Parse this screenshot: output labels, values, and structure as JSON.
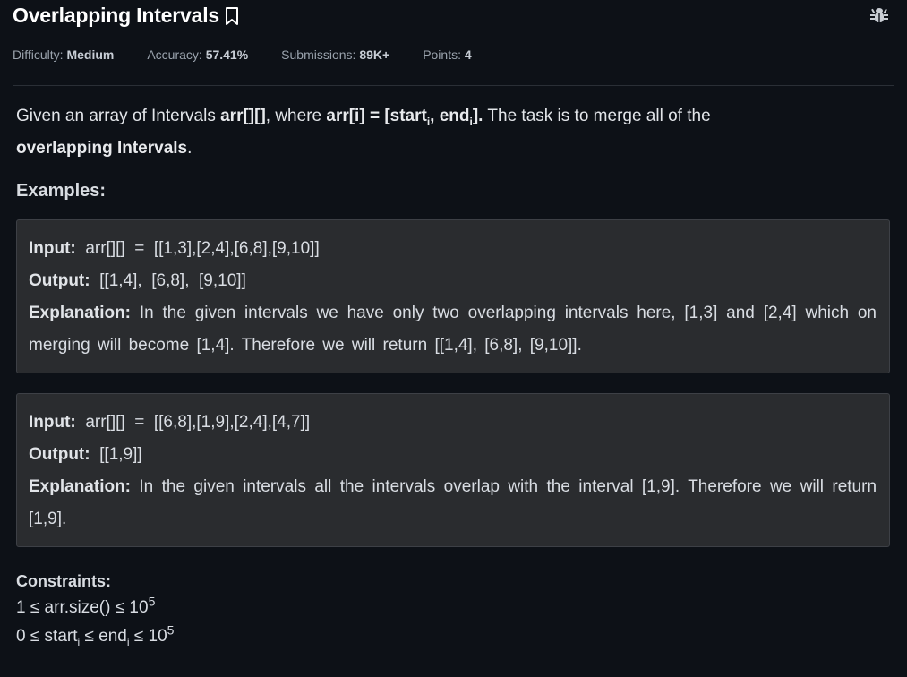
{
  "problem": {
    "title": "Overlapping Intervals",
    "meta": {
      "difficulty_label": "Difficulty:",
      "difficulty_value": "Medium",
      "accuracy_label": "Accuracy:",
      "accuracy_value": "57.41%",
      "submissions_label": "Submissions:",
      "submissions_value": "89K+",
      "points_label": "Points:",
      "points_value": "4"
    },
    "description": {
      "p1": "Given an array of Intervals ",
      "arr": "arr[][]",
      "p2": ", where ",
      "arri": "arr[i] = [start",
      "sub_i1": "i",
      "comma_end": ", end",
      "sub_i2": "i",
      "close": "].",
      "p3": " The task is to merge all of the ",
      "bold_end": "overlapping Intervals",
      "period": "."
    },
    "examples_heading": "Examples:",
    "examples": [
      {
        "input_label": "Input:",
        "input_value": "arr[][]  =  [[1,3],[2,4],[6,8],[9,10]]",
        "output_label": "Output:",
        "output_value": "[[1,4],  [6,8],  [9,10]]",
        "explanation_label": "Explanation:",
        "explanation_value": "In the given intervals we have only two overlapping intervals here, [1,3] and [2,4] which on merging will become [1,4]. Therefore we will return [[1,4], [6,8], [9,10]]."
      },
      {
        "input_label": "Input:",
        "input_value": "arr[][]  =  [[6,8],[1,9],[2,4],[4,7]]",
        "output_label": "Output:",
        "output_value": "[[1,9]]",
        "explanation_label": "Explanation:",
        "explanation_value": "In the given intervals all the intervals overlap with the interval [1,9]. Therefore we will return [1,9]."
      }
    ],
    "constraints_heading": "Constraints:",
    "constraints": [
      {
        "pre": "1 ≤ arr.size() ≤ 10",
        "sup": "5"
      },
      {
        "c0": "0 ≤ start",
        "s1": "i",
        "c1": " ≤ end",
        "s2": "i",
        "c2": " ≤ 10",
        "sup": "5"
      }
    ]
  },
  "icons": {
    "bookmark": "bookmark-icon",
    "bug": "bug-icon"
  },
  "colors": {
    "background": "#0d1117",
    "example_bg": "#2a2c2f",
    "title": "#ffffff",
    "meta_text": "#9aa3ad"
  }
}
